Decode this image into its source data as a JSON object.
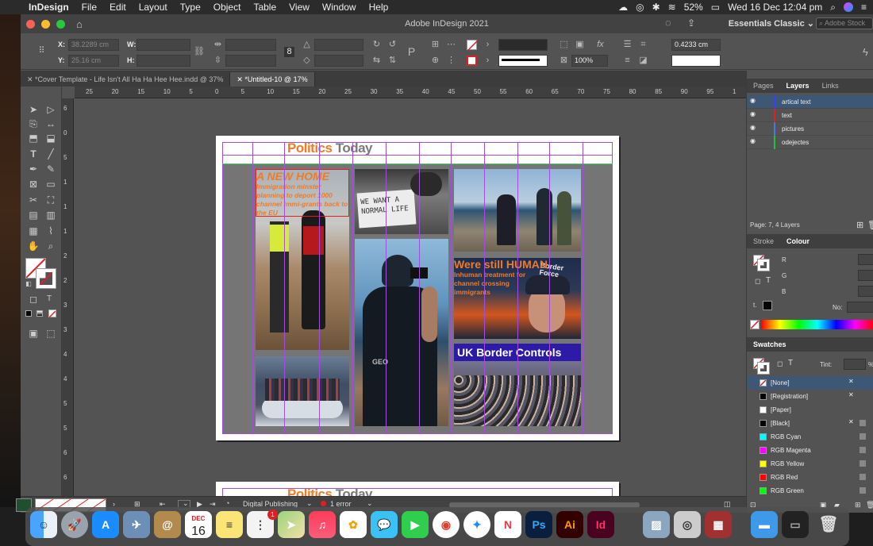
{
  "menubar": {
    "app": "InDesign",
    "items": [
      "File",
      "Edit",
      "Layout",
      "Type",
      "Object",
      "Table",
      "View",
      "Window",
      "Help"
    ],
    "battery": "52%",
    "clock": "Wed 16 Dec  12:04 pm"
  },
  "window": {
    "title": "Adobe InDesign 2021",
    "workspace": "Essentials Classic",
    "stock_placeholder": "Adobe Stock"
  },
  "control": {
    "x_label": "X:",
    "x_value": "38.2289 cm",
    "y_label": "Y:",
    "y_value": "25.16 cm",
    "w_label": "W:",
    "h_label": "H:",
    "stroke_weight": "0.4233 cm",
    "zoom": "100%"
  },
  "doc_tabs": [
    {
      "label": "*Cover Template - Life Isn't All Ha Ha Hee Hee.indd @ 37%",
      "active": false
    },
    {
      "label": "*Untitled-10 @ 17%",
      "active": true
    }
  ],
  "ruler": {
    "h": [
      "25",
      "20",
      "15",
      "10",
      "5",
      "0",
      "5",
      "10",
      "15",
      "20",
      "25",
      "30",
      "35",
      "40",
      "45",
      "50",
      "55",
      "60",
      "65",
      "70",
      "75",
      "80",
      "85",
      "90",
      "95",
      "1"
    ],
    "v": [
      "6",
      "0",
      "5",
      "1",
      "1",
      "1",
      "2",
      "2",
      "3",
      "3",
      "4",
      "4",
      "5",
      "5",
      "6",
      "6"
    ]
  },
  "page": {
    "masthead_a": "Politics",
    "masthead_b": "Today",
    "headline1": "A NEW HOME",
    "sub1": "Immigration minster planning to deport 1000 channel immi-grants back to the EU",
    "sign_text": "WE WANT A NORMAL LIFE",
    "headline2": "Were still HUMAN",
    "sub2": "Inhuman treatment for channel crossing immigrants",
    "vest_text": "Border Force",
    "banner": "UK Border Controls",
    "shirt_text": "GEO"
  },
  "status": {
    "preflight_profile": "Digital Publishing",
    "errors": "1 error"
  },
  "panels": {
    "layer_tabs": [
      "Pages",
      "Layers",
      "Links"
    ],
    "layers": [
      {
        "name": "artical text",
        "color": "#3c3cff"
      },
      {
        "name": "text",
        "color": "#e02020"
      },
      {
        "name": "pictures",
        "color": "#4a78e0"
      },
      {
        "name": "odejectes",
        "color": "#20c040"
      }
    ],
    "layers_status": "Page: 7, 4 Layers",
    "colour_tabs": [
      "Stroke",
      "Colour"
    ],
    "rgb": [
      "R",
      "G",
      "B"
    ],
    "no_label": "No:",
    "swatches_title": "Swatches",
    "tint_label": "Tint:",
    "tint_value": "%",
    "swatches": [
      {
        "name": "[None]",
        "color": "none"
      },
      {
        "name": "[Registration]",
        "color": "#000000"
      },
      {
        "name": "[Paper]",
        "color": "#ffffff"
      },
      {
        "name": "[Black]",
        "color": "#000000"
      },
      {
        "name": "RGB Cyan",
        "color": "#00ffff"
      },
      {
        "name": "RGB Magenta",
        "color": "#ff00ff"
      },
      {
        "name": "RGB Yellow",
        "color": "#ffff00"
      },
      {
        "name": "RGB Red",
        "color": "#ff0000"
      },
      {
        "name": "RGB Green",
        "color": "#00ff00"
      }
    ]
  },
  "dock": {
    "calendar_month": "DEC",
    "calendar_day": "16",
    "notification_count": "1",
    "apps": [
      "Finder",
      "Launchpad",
      "App Store",
      "Preview",
      "Contacts",
      "Calendar",
      "Notes",
      "Reminders",
      "Maps",
      "Music",
      "Photos",
      "Messages",
      "FaceTime",
      "Chrome",
      "Safari",
      "News",
      "Ps",
      "Ai",
      "Id",
      "Preview2",
      "Screenshot",
      "Photo Booth",
      "Folder",
      "Screen",
      "Trash"
    ]
  }
}
